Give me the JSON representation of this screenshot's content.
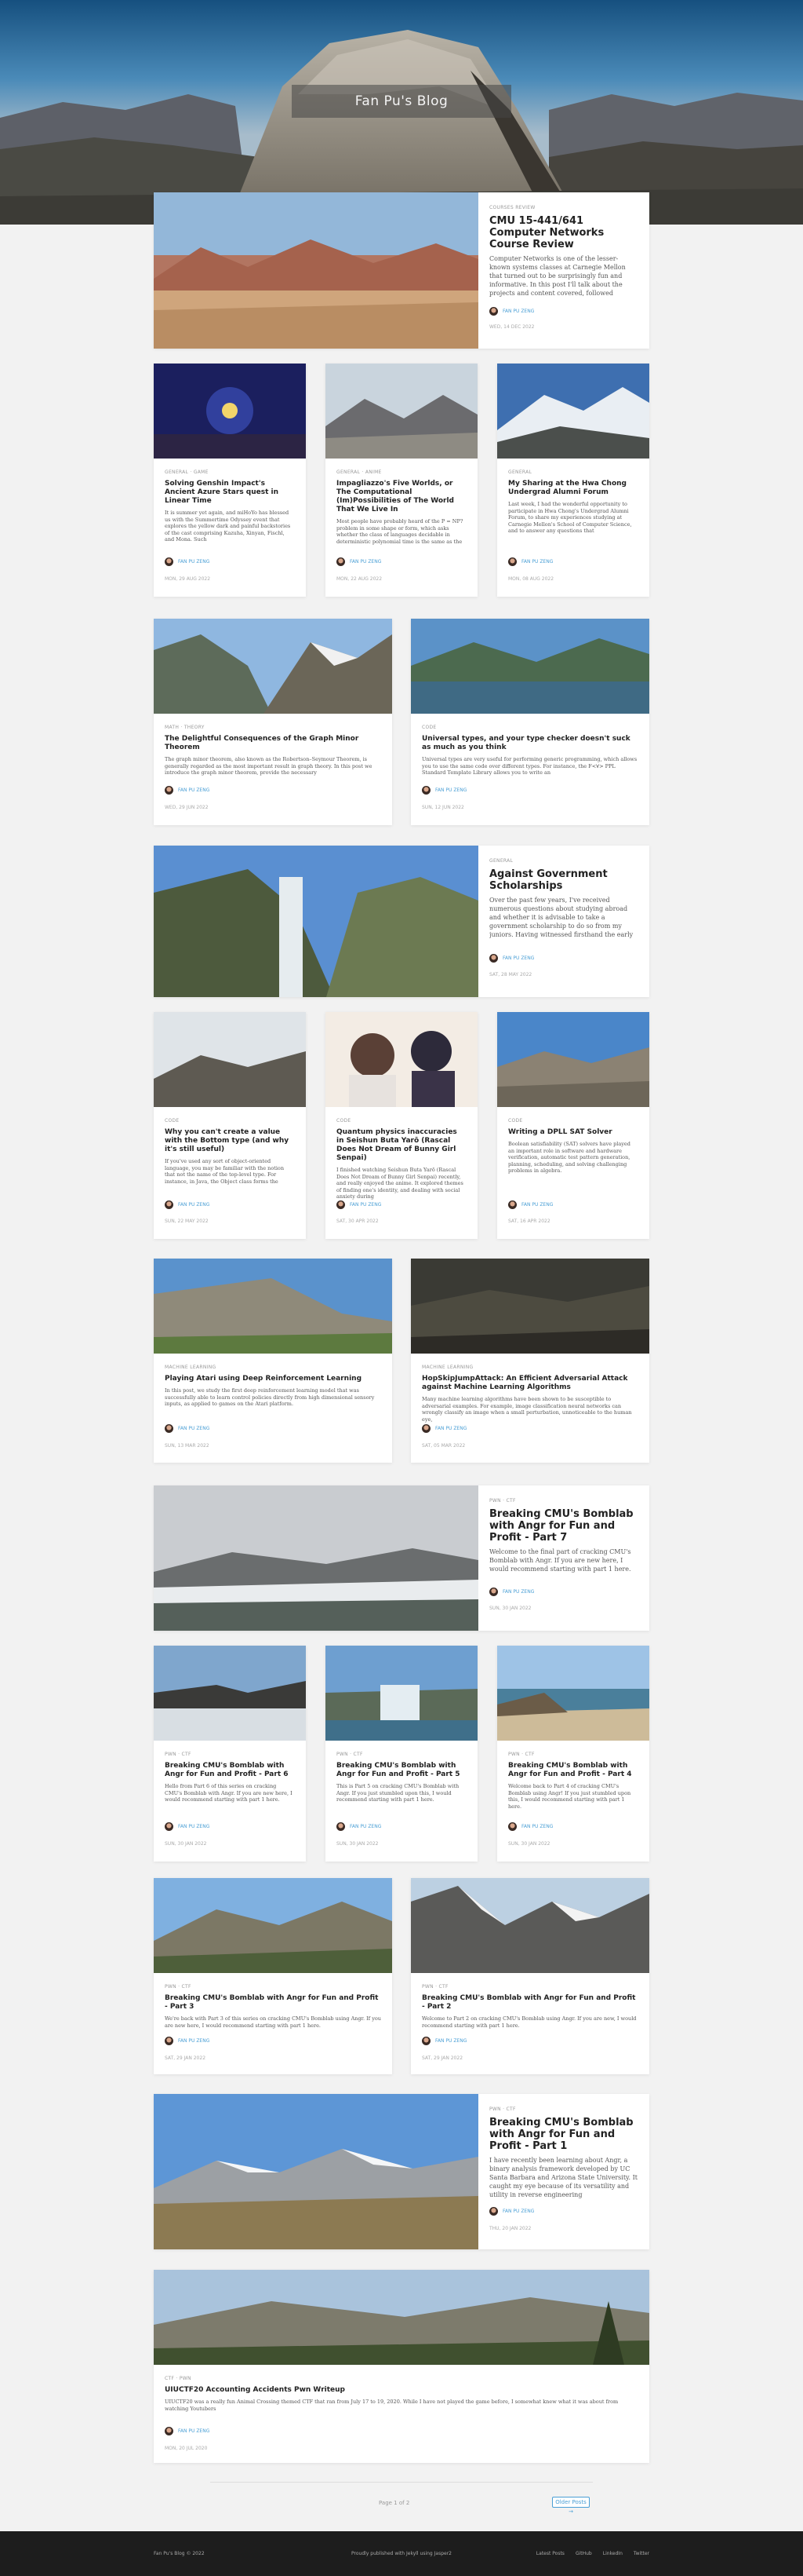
{
  "site": {
    "title": "Fan Pu's Blog"
  },
  "posts": [
    {
      "category": "Courses Review",
      "title": "CMU 15-441/641 Computer Networks Course Review",
      "excerpt": "Computer Networks is one of the lesser-known systems classes at Carnegie Mellon that turned out to be surprisingly fun and informative. In this post I'll talk about the projects and content covered, followed",
      "author": "Fan Pu Zeng",
      "date": "Wed, 14 Dec 2022"
    },
    {
      "category": "General · Game",
      "title": "Solving Genshin Impact's Ancient Azure Stars quest in Linear Time",
      "excerpt": "It is summer yet again, and miHoYo has blessed us with the Summertime Odyssey event that explores the yellow dark and painful backstories of the cast comprising Kazuha, Xinyan, Fischl, and Mona. Such",
      "author": "Fan Pu Zeng",
      "date": "Mon, 29 Aug 2022"
    },
    {
      "category": "General · Anime",
      "title": "Impagliazzo's Five Worlds, or The Computational (Im)Possibilities of The World That We Live In",
      "excerpt": "Most people have probably heard of the P = NP? problem in some shape or form, which asks whether the class of languages decidable in deterministic polynomial time is the same as the",
      "author": "Fan Pu Zeng",
      "date": "Mon, 22 Aug 2022"
    },
    {
      "category": "General",
      "title": "My Sharing at the Hwa Chong Undergrad Alumni Forum",
      "excerpt": "Last week, I had the wonderful opportunity to participate in Hwa Chong's Undergrad Alumni Forum, to share my experiences studying at Carnegie Mellon's School of Computer Science, and to answer any questions that",
      "author": "Fan Pu Zeng",
      "date": "Mon, 08 Aug 2022"
    },
    {
      "category": "Math · Theory",
      "title": "The Delightful Consequences of the Graph Minor Theorem",
      "excerpt": "The graph minor theorem, also known as the Robertson–Seymour Theorem, is generally regarded as the most important result in graph theory. In this post we introduce the graph minor theorem, provide the necessary",
      "author": "Fan Pu Zeng",
      "date": "Wed, 29 Jun 2022"
    },
    {
      "category": "Code",
      "title": "Universal types, and your type checker doesn't suck as much as you think",
      "excerpt": "Universal types are very useful for performing generic programming, which allows you to use the same code over different types. For instance, the F<∀> PPL Standard Template Library allows you to write an",
      "author": "Fan Pu Zeng",
      "date": "Sun, 12 Jun 2022"
    },
    {
      "category": "General",
      "title": "Against Government Scholarships",
      "excerpt": "Over the past few years, I've received numerous questions about studying abroad and whether it is advisable to take a government scholarship to do so from my juniors. Having witnessed firsthand the early",
      "author": "Fan Pu Zeng",
      "date": "Sat, 28 May 2022"
    },
    {
      "category": "Code",
      "title": "Why you can't create a value with the Bottom type (and why it's still useful)",
      "excerpt": "If you've used any sort of object-oriented language, you may be familiar with the notion that not the name of the top-level type. For instance, in Java, the Object class forms the",
      "author": "Fan Pu Zeng",
      "date": "Sun, 22 May 2022"
    },
    {
      "category": "Code",
      "title": "Quantum physics inaccuracies in Seishun Buta Yarō (Rascal Does Not Dream of Bunny Girl Senpai)",
      "excerpt": "I finished watching Seishun Buta Yarō (Rascal Does Not Dream of Bunny Girl Senpai) recently, and really enjoyed the anime. It explored themes of finding one's identity, and dealing with social anxiety during",
      "author": "Fan Pu Zeng",
      "date": "Sat, 30 Apr 2022"
    },
    {
      "category": "Code",
      "title": "Writing a DPLL SAT Solver",
      "excerpt": "Boolean satisfiability (SAT) solvers have played an important role in software and hardware verification, automatic test pattern generation, planning, scheduling, and solving challenging problems in algebra.",
      "author": "Fan Pu Zeng",
      "date": "Sat, 16 Apr 2022"
    },
    {
      "category": "Machine Learning",
      "title": "Playing Atari using Deep Reinforcement Learning",
      "excerpt": "In this post, we study the first deep reinforcement learning model that was successfully able to learn control policies directly from high dimensional sensory inputs, as applied to games on the Atari platform.",
      "author": "Fan Pu Zeng",
      "date": "Sun, 13 Mar 2022"
    },
    {
      "category": "Machine Learning",
      "title": "HopSkipJumpAttack: An Efficient Adversarial Attack against Machine Learning Algorithms",
      "excerpt": "Many machine learning algorithms have been shown to be susceptible to adversarial examples. For example, image classification neural networks can wrongly classify an image when a small perturbation, unnoticeable to the human eye,",
      "author": "Fan Pu Zeng",
      "date": "Sat, 05 Mar 2022"
    },
    {
      "category": "Pwn · CTF",
      "title": "Breaking CMU's Bomblab with Angr for Fun and Profit - Part 7",
      "excerpt": "Welcome to the final part of cracking CMU's Bomblab with Angr. If you are new here, I would recommend starting with part 1 here.",
      "author": "Fan Pu Zeng",
      "date": "Sun, 30 Jan 2022"
    },
    {
      "category": "Pwn · CTF",
      "title": "Breaking CMU's Bomblab with Angr for Fun and Profit - Part 6",
      "excerpt": "Hello from Part 6 of this series on cracking CMU's Bomblab with Angr. If you are new here, I would recommend starting with part 1 here.",
      "author": "Fan Pu Zeng",
      "date": "Sun, 30 Jan 2022"
    },
    {
      "category": "Pwn · CTF",
      "title": "Breaking CMU's Bomblab with Angr for Fun and Profit - Part 5",
      "excerpt": "This is Part 5 on cracking CMU's Bomblab with Angr. If you just stumbled upon this, I would recommend starting with part 1 here.",
      "author": "Fan Pu Zeng",
      "date": "Sun, 30 Jan 2022"
    },
    {
      "category": "Pwn · CTF",
      "title": "Breaking CMU's Bomblab with Angr for Fun and Profit - Part 4",
      "excerpt": "Welcome back to Part 4 of cracking CMU's Bomblab using Angr! If you just stumbled upon this, I would recommend starting with part 1 here.",
      "author": "Fan Pu Zeng",
      "date": "Sun, 30 Jan 2022"
    },
    {
      "category": "Pwn · CTF",
      "title": "Breaking CMU's Bomblab with Angr for Fun and Profit - Part 3",
      "excerpt": "We're back with Part 3 of this series on cracking CMU's Bomblab using Angr. If you are new here, I would recommend starting with part 1 here.",
      "author": "Fan Pu Zeng",
      "date": "Sat, 29 Jan 2022"
    },
    {
      "category": "Pwn · CTF",
      "title": "Breaking CMU's Bomblab with Angr for Fun and Profit - Part 2",
      "excerpt": "Welcome to Part 2 on cracking CMU's Bomblab using Angr. If you are new, I would recommend starting with part 1 here.",
      "author": "Fan Pu Zeng",
      "date": "Sat, 29 Jan 2022"
    },
    {
      "category": "Pwn · CTF",
      "title": "Breaking CMU's Bomblab with Angr for Fun and Profit - Part 1",
      "excerpt": "I have recently been learning about Angr, a binary analysis framework developed by UC Santa Barbara and Arizona State University. It caught my eye because of its versatility and utility in reverse engineering",
      "author": "Fan Pu Zeng",
      "date": "Thu, 20 Jan 2022"
    },
    {
      "category": "CTF · Pwn",
      "title": "UIUCTF20 Accounting Accidents Pwn Writeup",
      "excerpt": "UIUCTF20 was a really fun Animal Crossing themed CTF that ran from July 17 to 19, 2020. While I have not played the game before, I somewhat knew what it was about from watching Youtubers",
      "author": "Fan Pu Zeng",
      "date": "Mon, 20 Jul 2020"
    }
  ],
  "pagination": {
    "page_text": "Page 1 of 2",
    "older_label": "Older Posts →"
  },
  "footer": {
    "copyright": "Fan Pu's Blog © 2022",
    "powered": "Proudly published with Jekyll using Jasper2",
    "links": [
      "Latest Posts",
      "GitHub",
      "LinkedIn",
      "Twitter"
    ]
  }
}
